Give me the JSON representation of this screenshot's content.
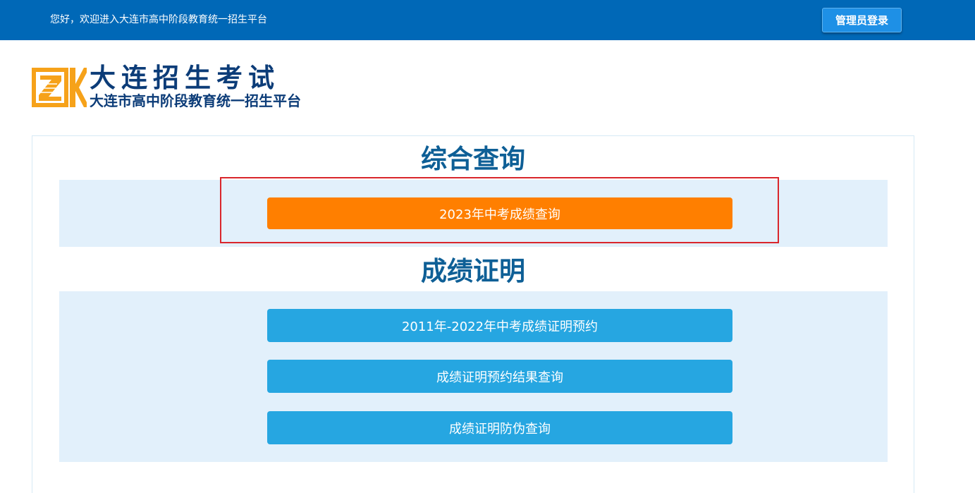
{
  "topbar": {
    "welcome": "您好，欢迎进入大连市高中阶段教育统一招生平台",
    "admin_login": "管理员登录"
  },
  "logo": {
    "title": "大连招生考试",
    "subtitle": "大连市高中阶段教育统一招生平台",
    "icon": "zk-logo-icon"
  },
  "sections": [
    {
      "title": "综合查询",
      "buttons": [
        {
          "label": "2023年中考成绩查询"
        }
      ]
    },
    {
      "title": "成绩证明",
      "buttons": [
        {
          "label": "2011年-2022年中考成绩证明预约"
        },
        {
          "label": "成绩证明预约结果查询"
        },
        {
          "label": "成绩证明防伪查询"
        }
      ]
    }
  ],
  "colors": {
    "topbar": "#0068b7",
    "accent_orange": "#ff7f00",
    "accent_blue": "#26a6e1",
    "band": "#e2f0fb",
    "title": "#0e5f96",
    "highlight": "#d9262c"
  }
}
